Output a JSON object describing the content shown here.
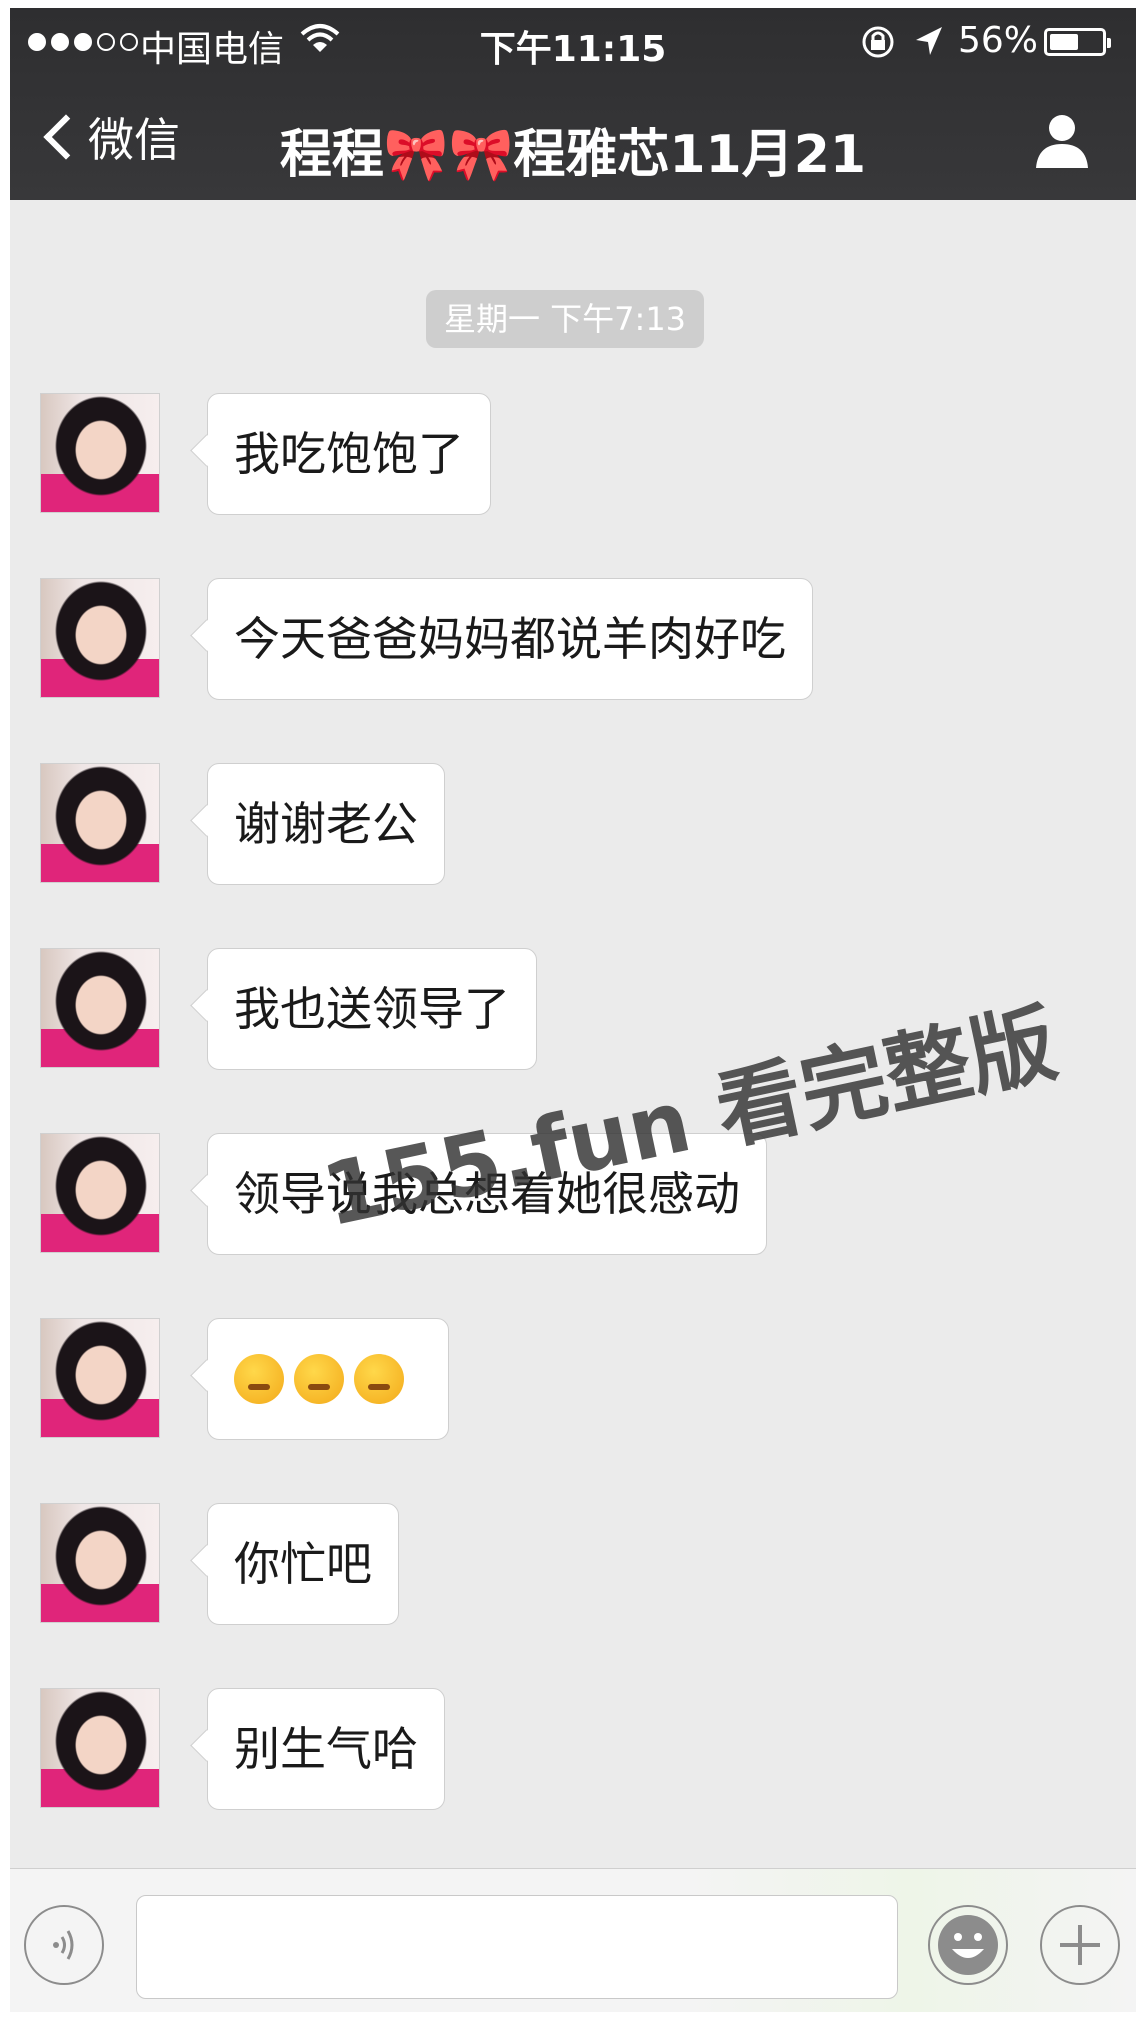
{
  "status_bar": {
    "carrier": "中国电信",
    "time": "下午11:15",
    "battery_percent": "56%",
    "battery_level": 0.56,
    "signal_strength": 3,
    "signal_total": 5
  },
  "nav": {
    "back_label": "微信",
    "title": "程程🎀🎀程雅芯11月21"
  },
  "chat": {
    "timestamp": "星期一 下午7:13",
    "messages": [
      {
        "text": "我吃饱饱了"
      },
      {
        "text": "今天爸爸妈妈都说羊肉好吃"
      },
      {
        "text": "谢谢老公"
      },
      {
        "text": "我也送领导了"
      },
      {
        "text": "领导说我总想着她很感动"
      },
      {
        "text": "",
        "emoji": [
          "thinking-face-emoji",
          "thinking-face-emoji",
          "thinking-face-emoji"
        ]
      },
      {
        "text": "你忙吧"
      },
      {
        "text": "别生气哈"
      }
    ]
  },
  "watermark": "155.fun 看完整版",
  "input": {
    "value": "",
    "placeholder": ""
  },
  "colors": {
    "nav_bg": "#2e2e30",
    "chat_bg": "#ebebeb",
    "bubble_bg": "#ffffff",
    "timestamp_bg": "#cecece"
  }
}
